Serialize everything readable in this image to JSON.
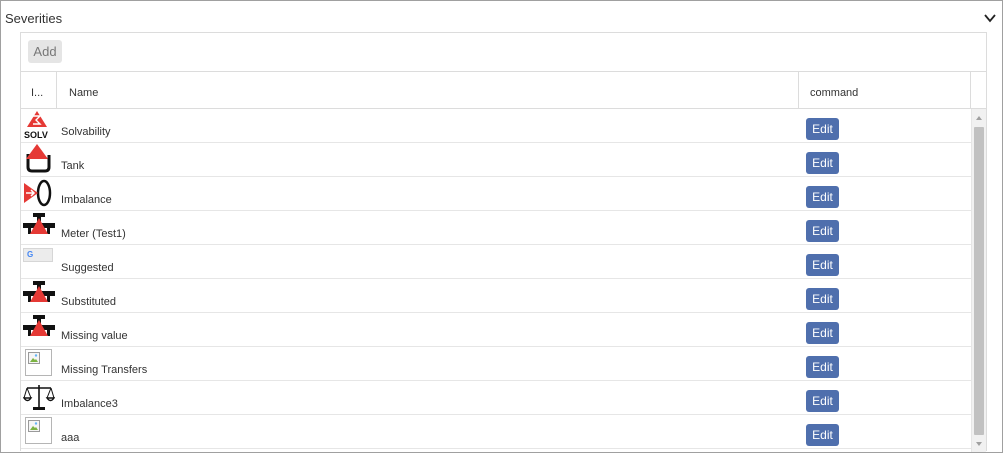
{
  "panel": {
    "title": "Severities",
    "expanded": true
  },
  "toolbar": {
    "add_label": "Add"
  },
  "columns": {
    "icon": "I...",
    "name": "Name",
    "command": "command"
  },
  "rows": [
    {
      "name": "Solvability",
      "icon": "solv-icon",
      "edit_label": "Edit"
    },
    {
      "name": "Tank",
      "icon": "tank-icon",
      "edit_label": "Edit"
    },
    {
      "name": "Imbalance",
      "icon": "imbalance-icon",
      "edit_label": "Edit"
    },
    {
      "name": "Meter (Test1)",
      "icon": "meter-icon",
      "edit_label": "Edit"
    },
    {
      "name": "Suggested",
      "icon": "google-label-icon",
      "edit_label": "Edit"
    },
    {
      "name": "Substituted",
      "icon": "meter-icon",
      "edit_label": "Edit"
    },
    {
      "name": "Missing value",
      "icon": "meter-icon",
      "edit_label": "Edit"
    },
    {
      "name": "Missing Transfers",
      "icon": "broken-image-icon",
      "edit_label": "Edit"
    },
    {
      "name": "Imbalance3",
      "icon": "scales-icon",
      "edit_label": "Edit"
    },
    {
      "name": "aaa",
      "icon": "broken-image-icon",
      "edit_label": "Edit"
    }
  ],
  "colors": {
    "edit_button": "#4f6fad",
    "alert_red": "#e53935"
  },
  "solv_icon_text": "SOLV",
  "google_icon_text": "G"
}
